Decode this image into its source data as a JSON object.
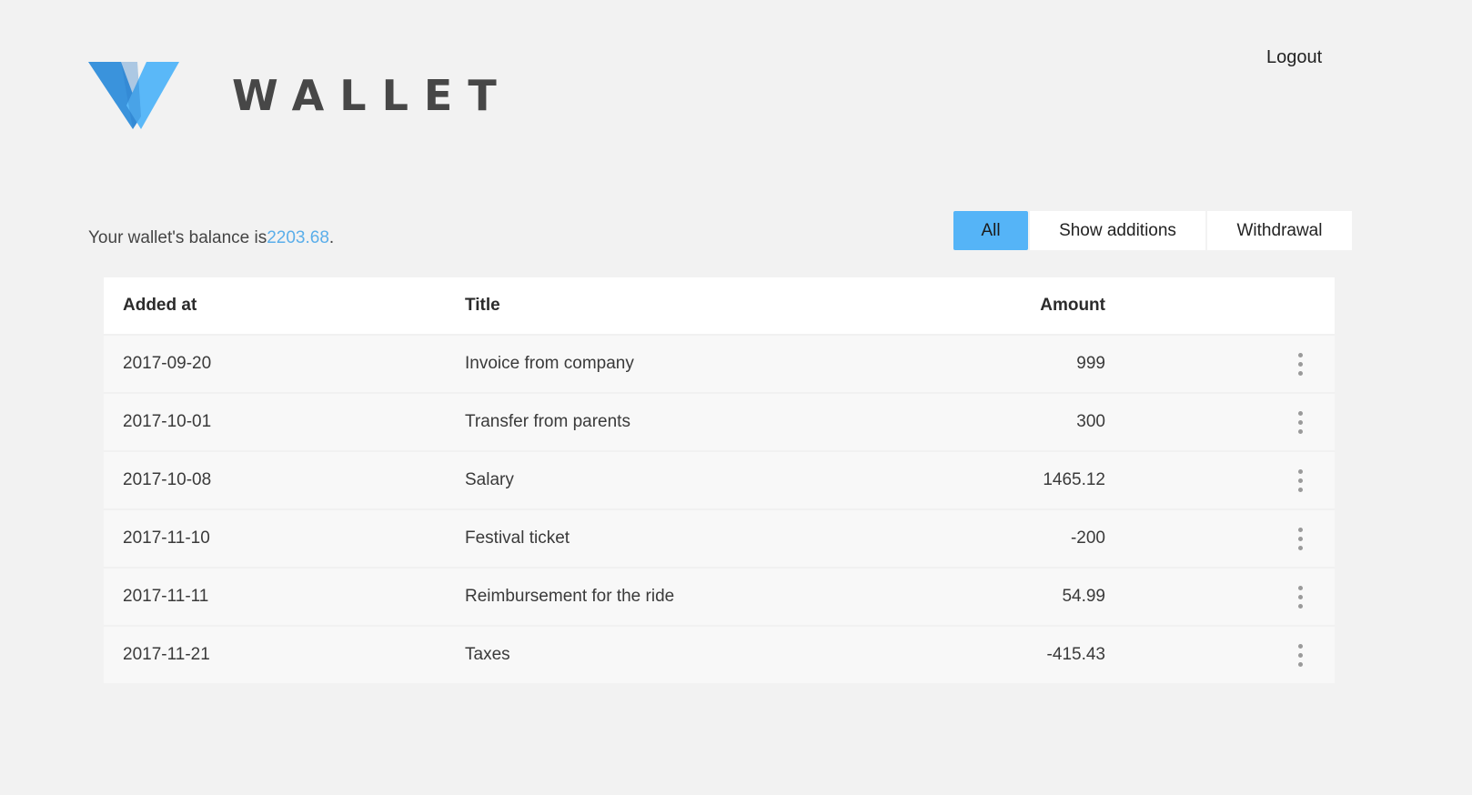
{
  "app": {
    "logo_text": "WALLET",
    "logout_label": "Logout"
  },
  "balance": {
    "prefix": "Your wallet's balance is",
    "amount": "2203.68",
    "suffix": "."
  },
  "filters": [
    {
      "label": "All",
      "active": true
    },
    {
      "label": "Show additions",
      "active": false
    },
    {
      "label": "Withdrawal",
      "active": false
    }
  ],
  "table": {
    "headers": {
      "added_at": "Added at",
      "title": "Title",
      "amount": "Amount"
    },
    "rows": [
      {
        "added_at": "2017-09-20",
        "title": "Invoice from company",
        "amount": "999"
      },
      {
        "added_at": "2017-10-01",
        "title": "Transfer from parents",
        "amount": "300"
      },
      {
        "added_at": "2017-10-08",
        "title": "Salary",
        "amount": "1465.12"
      },
      {
        "added_at": "2017-11-10",
        "title": "Festival ticket",
        "amount": "-200"
      },
      {
        "added_at": "2017-11-11",
        "title": "Reimbursement for the ride",
        "amount": "54.99"
      },
      {
        "added_at": "2017-11-21",
        "title": "Taxes",
        "amount": "-415.43"
      }
    ]
  },
  "colors": {
    "accent": "#55b4f7",
    "balance_amount": "#5aaeea",
    "logo_dark": "#2f8bd8",
    "logo_light": "#5ab8f8"
  },
  "icons": {
    "logo": "wallet-logo-icon",
    "row_menu": "kebab-menu-icon"
  }
}
